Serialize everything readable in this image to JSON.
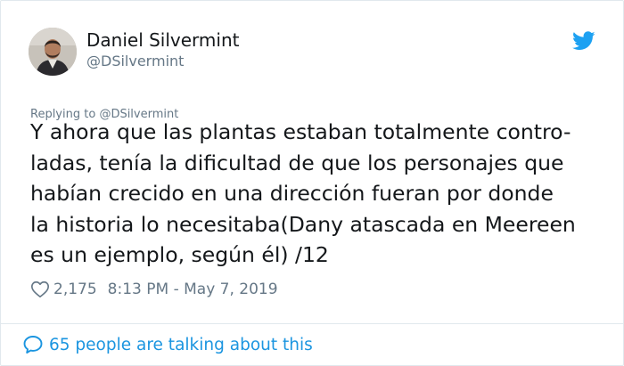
{
  "tweet": {
    "author": {
      "display_name": "Daniel Silvermint",
      "handle": "@DSilvermint",
      "avatar_icon": "user-avatar-photo"
    },
    "brand_icon": "twitter-bird-icon",
    "brand_color": "#1da1f2",
    "reply_context": {
      "prefix": "Replying to ",
      "mention": "@DSilvermint"
    },
    "text": "Y ahora que las plantas estaban totalmente contro-\nladas, tenía la dificultad de que los personajes que\nhabían crecido en una dirección fueran por donde\nla historia lo necesitaba(Dany atascada en Meereen\nes un ejemplo, según él)           /12",
    "likes": "2,175",
    "timestamp": "8:13 PM - May 7, 2019"
  },
  "footer": {
    "talking_text": "65 people are talking about this",
    "icon": "speech-bubble-icon",
    "link_color": "#1b95e0"
  }
}
